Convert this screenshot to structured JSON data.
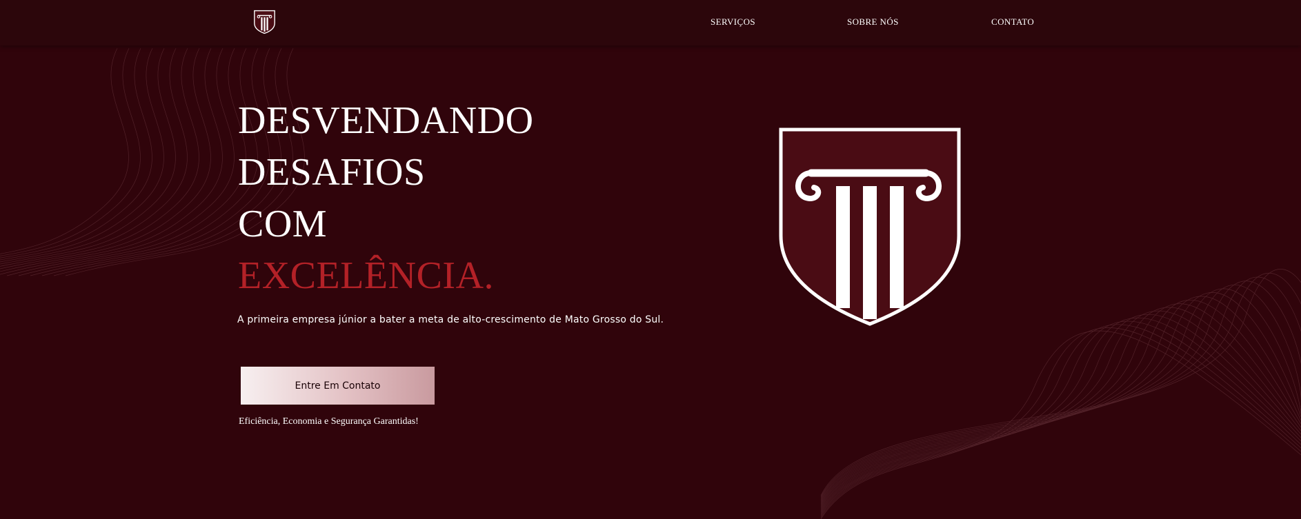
{
  "nav": {
    "logo_icon": "column-shield-icon",
    "items": [
      {
        "label": "SERVIÇOS"
      },
      {
        "label": "SOBRE NÓS"
      },
      {
        "label": "CONTATO"
      }
    ]
  },
  "hero": {
    "title_lines": [
      "DESVENDANDO",
      "DESAFIOS",
      "COM"
    ],
    "title_accent": "EXCELÊNCIA.",
    "subtitle": "A primeira empresa júnior a bater a meta de alto-crescimento de Mato Grosso do Sul.",
    "cta_label": "Entre Em Contato",
    "tagline": "Eficiência, Economia e Segurança Garantidas!",
    "emblem_icon": "column-shield-icon"
  },
  "colors": {
    "background": "#30040b",
    "navbar": "#2c060b",
    "accent": "#b32127",
    "emblem_fill": "#4a0c14",
    "text": "#ffffff"
  }
}
